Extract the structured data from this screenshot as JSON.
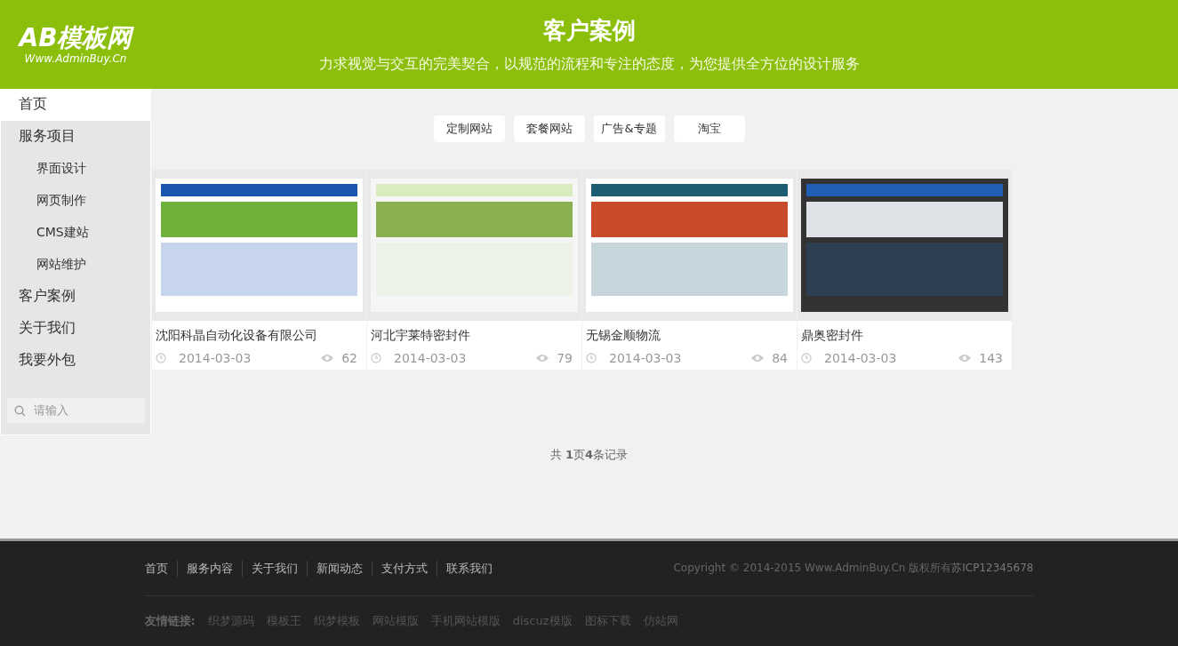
{
  "header": {
    "logo_title": "AB模板网",
    "logo_subtitle": "Www.AdminBuy.Cn",
    "title": "客户案例",
    "subtitle": "力求视觉与交互的完美契合，以规范的流程和专注的态度，为您提供全方位的设计服务"
  },
  "sidebar": {
    "items": [
      {
        "label": "首页",
        "selected": true
      },
      {
        "label": "服务项目",
        "selected": false,
        "children": [
          {
            "label": "界面设计",
            "selected": false
          },
          {
            "label": "网页制作",
            "selected": false
          },
          {
            "label": "CMS建站",
            "selected": false
          },
          {
            "label": "网站维护",
            "selected": false
          }
        ]
      },
      {
        "label": "客户案例",
        "selected": false
      },
      {
        "label": "关于我们",
        "selected": false
      },
      {
        "label": "我要外包",
        "selected": false
      }
    ],
    "search": {
      "placeholder": "请输入"
    }
  },
  "tabs": [
    {
      "label": "定制网站",
      "selected": false
    },
    {
      "label": "套餐网站",
      "selected": false
    },
    {
      "label": "广告&专题",
      "selected": false
    },
    {
      "label": "淘宝",
      "selected": false
    }
  ],
  "cases": [
    {
      "title": "沈阳科晶自动化设备有限公司",
      "date": "2014-03-03",
      "views": "62"
    },
    {
      "title": "河北宇莱特密封件",
      "date": "2014-03-03",
      "views": "79"
    },
    {
      "title": "无锡金顺物流",
      "date": "2014-03-03",
      "views": "84"
    },
    {
      "title": "鼎奥密封件",
      "date": "2014-03-03",
      "views": "143"
    }
  ],
  "pagination": "共 **1**页**4**条记录",
  "footer": {
    "links": [
      "首页",
      "服务内容",
      "关于我们",
      "新闻动态",
      "支付方式",
      "联系我们"
    ],
    "copyright": "Copyright © 2014-2015 Www.AdminBuy.Cn 版权所有",
    "icp": "苏ICP12345678",
    "friend_label": "友情链接:",
    "friend_links": [
      "织梦源码",
      "模板王",
      "织梦模板",
      "网站模版",
      "手机网站模版",
      "discuz模版",
      "图标下载",
      "仿站网"
    ]
  }
}
